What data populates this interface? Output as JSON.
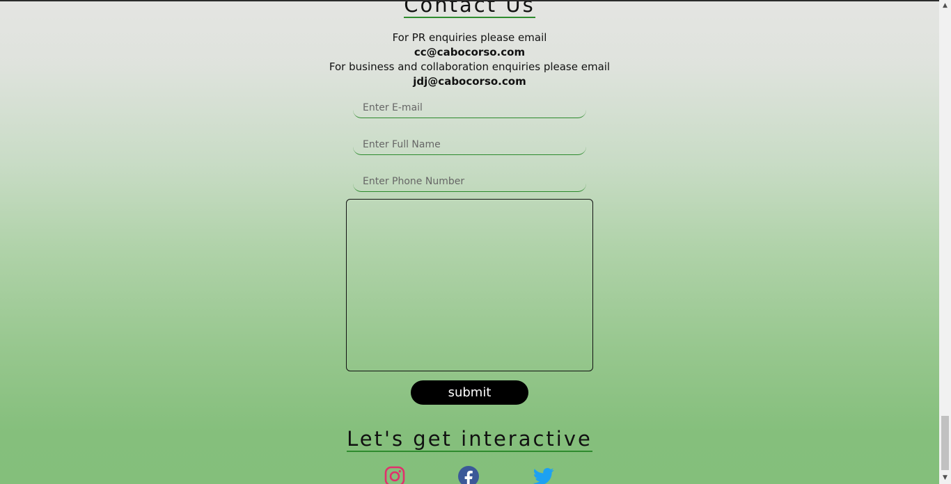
{
  "contact": {
    "heading": "Contact Us",
    "pr_text": "For PR enquiries please email",
    "pr_email": "cc@cabocorso.com",
    "business_text": "For business and collaboration enquiries please email",
    "business_email": "jdj@cabocorso.com"
  },
  "form": {
    "email_placeholder": "Enter E-mail",
    "name_placeholder": "Enter Full Name",
    "phone_placeholder": "Enter Phone Number",
    "message_value": "",
    "submit_label": "submit"
  },
  "social": {
    "heading": "Let's get interactive",
    "icons": [
      "instagram-icon",
      "facebook-icon",
      "twitter-icon"
    ]
  },
  "colors": {
    "accent_underline": "#2e8b2e",
    "instagram": "#e1306c",
    "facebook": "#3b5998",
    "twitter": "#1da1f2"
  }
}
